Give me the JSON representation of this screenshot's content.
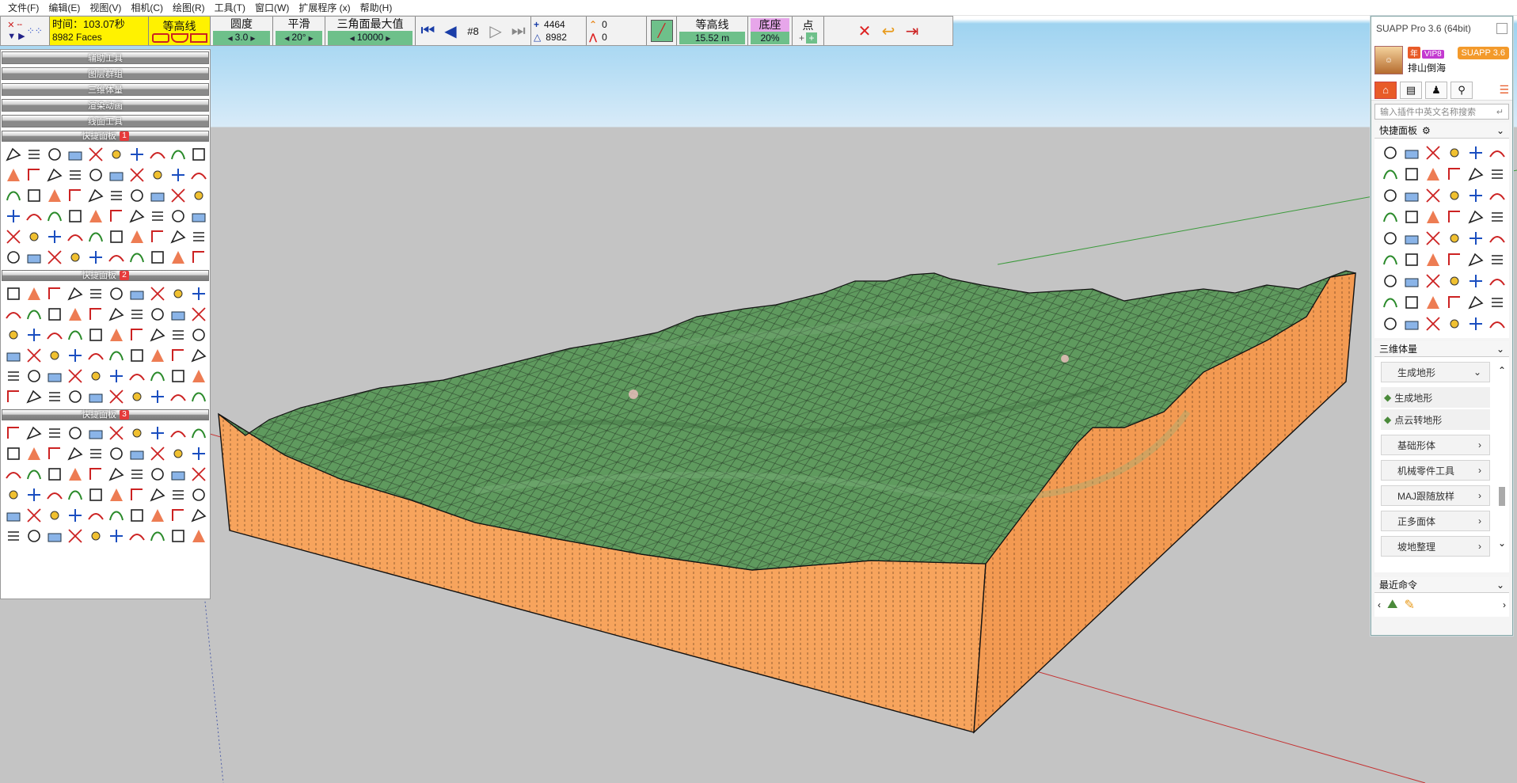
{
  "menu": [
    "文件(F)",
    "编辑(E)",
    "视图(V)",
    "相机(C)",
    "绘图(R)",
    "工具(T)",
    "窗口(W)",
    "扩展程序 (x)",
    "帮助(H)"
  ],
  "toolbar": {
    "time_label": "时间：103.07秒",
    "faces_label": "8982 Faces",
    "contour_top": "等高线",
    "round_head": "圆度",
    "round_val": "3.0",
    "smooth_head": "平滑",
    "smooth_val": "20°",
    "tri_head": "三角面最大值",
    "tri_val": "10000",
    "frame_label": "#8",
    "points_count": "4464",
    "tri_count": "8982",
    "up_count": "0",
    "down_count": "0",
    "contour_head": "等高线",
    "contour_val": "15.52 m",
    "base_head": "底座",
    "base_val": "20%",
    "point_head": "点"
  },
  "left_panel": {
    "sections": [
      "辅助工具",
      "图层群组",
      "三维体量",
      "渲染动画",
      "线面工具"
    ],
    "quick1_title": "快捷面板",
    "quick1_num": "1",
    "quick2_title": "快捷面板",
    "quick2_num": "2",
    "quick3_title": "快捷面板",
    "quick3_num": "3"
  },
  "suapp": {
    "title": "SUAPP Pro 3.6 (64bit)",
    "brand": "SUAPP 3.6",
    "user": "排山倒海",
    "badge_year": "年",
    "badge_vip": "VIP8",
    "search_placeholder": "输入插件中英文名称搜索",
    "quick_panel": "快捷面板",
    "section_3d": "三维体量",
    "items": [
      {
        "label": "生成地形",
        "kind": "group"
      },
      {
        "label": "生成地形",
        "kind": "tool"
      },
      {
        "label": "点云转地形",
        "kind": "tool"
      },
      {
        "label": "基础形体",
        "kind": "group"
      },
      {
        "label": "机械零件工具",
        "kind": "group"
      },
      {
        "label": "MAJ跟随放样",
        "kind": "group"
      },
      {
        "label": "正多面体",
        "kind": "group"
      },
      {
        "label": "坡地整理",
        "kind": "group"
      }
    ],
    "recent": "最近命令"
  },
  "colors": {
    "terrain_top": "#5f9a5e",
    "terrain_side": "#f7a45d",
    "accent": "#e85b28"
  }
}
